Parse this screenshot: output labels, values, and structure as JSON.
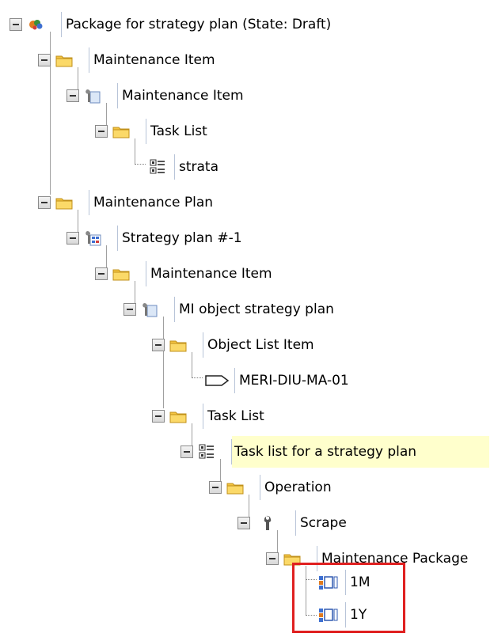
{
  "tree": {
    "nodes": [
      {
        "label": "Package for strategy plan (State: Draft)",
        "icon": "package-icon"
      },
      {
        "label": "Maintenance Item",
        "icon": "folder-icon"
      },
      {
        "label": "Maintenance Item",
        "icon": "maintenance-item-icon"
      },
      {
        "label": "Task List",
        "icon": "folder-icon"
      },
      {
        "label": "strata",
        "icon": "task-list-icon"
      },
      {
        "label": "Maintenance Plan",
        "icon": "folder-icon"
      },
      {
        "label": "Strategy plan #-1",
        "icon": "strategy-plan-icon"
      },
      {
        "label": "Maintenance Item",
        "icon": "folder-icon"
      },
      {
        "label": "MI object strategy plan",
        "icon": "maintenance-item-icon"
      },
      {
        "label": "Object List Item",
        "icon": "folder-icon"
      },
      {
        "label": "MERI-DIU-MA-01",
        "icon": "equipment-tag-icon"
      },
      {
        "label": "Task List",
        "icon": "folder-icon"
      },
      {
        "label": "Task list for a strategy plan",
        "icon": "task-list-icon",
        "selected": true
      },
      {
        "label": "Operation",
        "icon": "folder-icon"
      },
      {
        "label": "Scrape",
        "icon": "wrench-icon"
      },
      {
        "label": "Maintenance Package",
        "icon": "folder-icon"
      },
      {
        "label": "1M",
        "icon": "maintenance-package-icon"
      },
      {
        "label": "1Y",
        "icon": "maintenance-package-icon"
      }
    ],
    "highlight_color": "#e02020",
    "selected_color": "#ffffcc"
  }
}
